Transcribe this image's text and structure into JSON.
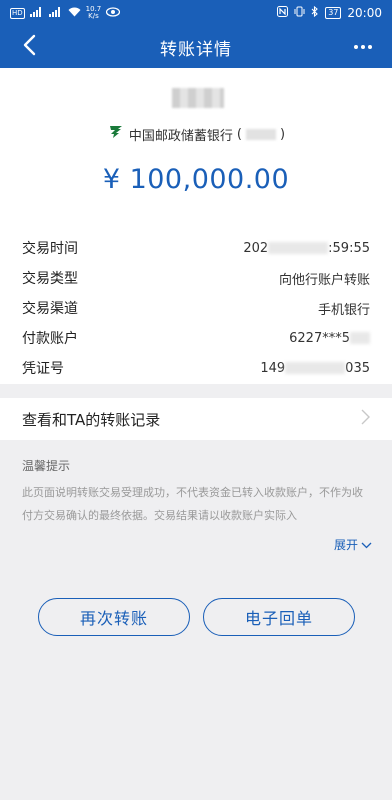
{
  "status_bar": {
    "left_badges": [
      "HD",
      "⁴⁶",
      "⁴⁶"
    ],
    "net_speed": "10.7",
    "net_unit": "K/s",
    "battery": "37",
    "time": "20:00"
  },
  "header": {
    "title": "转账详情"
  },
  "transfer": {
    "bank_name": "中国邮政储蓄银行",
    "paren_open": "(",
    "paren_close": ")",
    "amount": "¥ 100,000.00"
  },
  "details": [
    {
      "label": "交易时间",
      "value_prefix": "202",
      "value_suffix": ":59:55"
    },
    {
      "label": "交易类型",
      "value": "向他行账户转账"
    },
    {
      "label": "交易渠道",
      "value": "手机银行"
    },
    {
      "label": "付款账户",
      "value_prefix": "6227***5",
      "value_suffix": ""
    },
    {
      "label": "凭证号",
      "value_prefix": "149",
      "value_suffix": "035"
    }
  ],
  "record": {
    "label": "查看和TA的转账记录"
  },
  "tips": {
    "title": "温馨提示",
    "body": "此页面说明转账交易受理成功，不代表资金已转入收款账户，不作为收付方交易确认的最终依据。交易结果请以收款账户实际入",
    "expand_label": "展开"
  },
  "actions": {
    "again_label": "再次转账",
    "receipt_label": "电子回单"
  },
  "colors": {
    "brand": "#1a5fb8",
    "postal_green": "#1a7a3a",
    "background": "#efeff1"
  }
}
